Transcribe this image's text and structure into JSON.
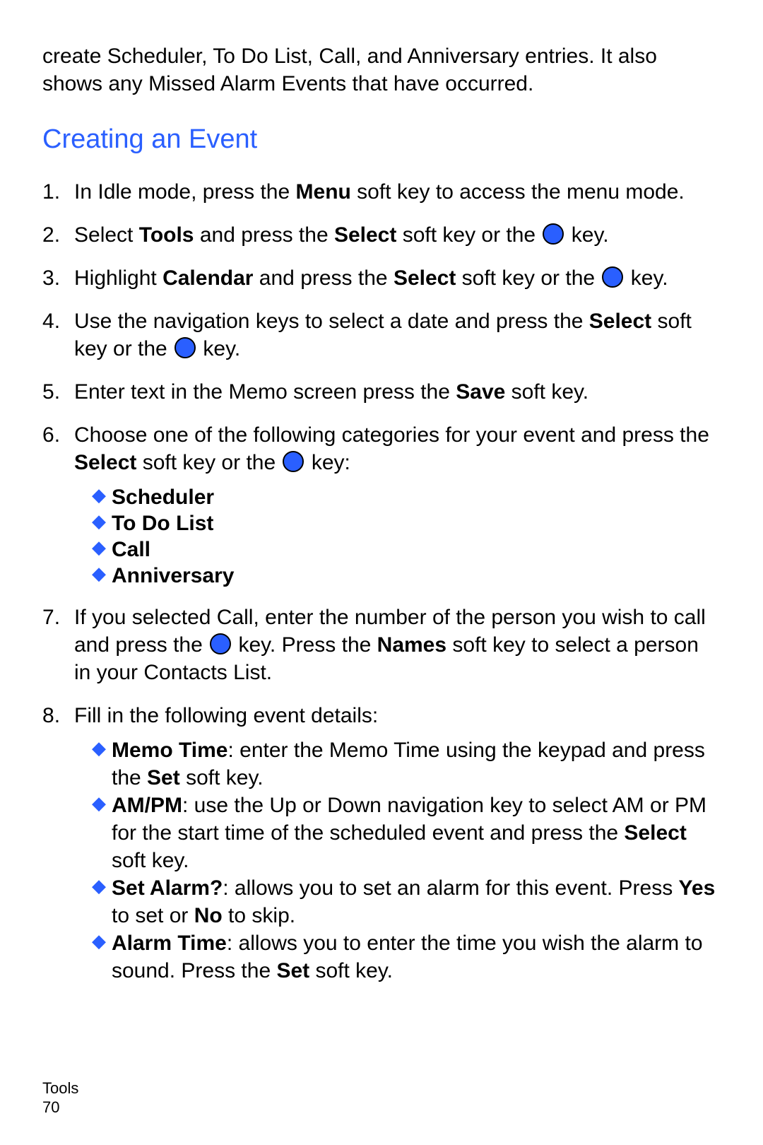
{
  "intro": "create Scheduler, To Do List, Call, and Anniversary entries. It also shows any Missed Alarm Events that have occurred.",
  "heading": "Creating an Event",
  "steps": {
    "s1": {
      "pre": "In Idle mode, press the ",
      "b1": "Menu",
      "post": " soft key to access the menu mode."
    },
    "s2": {
      "pre": "Select ",
      "b1": "Tools",
      "mid": " and press the ",
      "b2": "Select",
      "post1": " soft key or the ",
      "post2": " key."
    },
    "s3": {
      "pre": "Highlight ",
      "b1": "Calendar",
      "mid": " and press the ",
      "b2": "Select",
      "post1": " soft key or the ",
      "post2": " key."
    },
    "s4": {
      "pre": "Use the navigation keys to select a date and press the ",
      "b1": "Select",
      "post1": " soft key or the ",
      "post2": " key."
    },
    "s5": {
      "pre": "Enter text in the Memo screen press the ",
      "b1": "Save",
      "post": " soft key."
    },
    "s6": {
      "pre": "Choose one of the following categories for your event and press the ",
      "b1": "Select",
      "post1": " soft key or the ",
      "post2": " key:"
    },
    "s7": {
      "pre": "If you selected Call, enter the number of the person you wish to call and press the ",
      "post1": " key. Press the ",
      "b1": "Names",
      "post2": " soft key to select a person in your Contacts List."
    },
    "s8": "Fill in the following event details:"
  },
  "categories": {
    "c1": "Scheduler",
    "c2": "To Do List",
    "c3": "Call",
    "c4": "Anniversary"
  },
  "details": {
    "d1": {
      "b1": "Memo Time",
      "t1": ": enter the Memo Time using the keypad and press the ",
      "b2": "Set",
      "t2": " soft key."
    },
    "d2": {
      "b1": "AM/PM",
      "t1": ": use the Up or Down navigation key to select AM or PM for the start time of the scheduled event and press the ",
      "b2": "Select",
      "t2": " soft key."
    },
    "d3": {
      "b1": "Set Alarm?",
      "t1": ": allows you to set an alarm for this event. Press ",
      "b2": "Yes",
      "t2": " to set or ",
      "b3": "No",
      "t3": " to skip."
    },
    "d4": {
      "b1": "Alarm Time",
      "t1": ": allows you to enter the time you wish the alarm to sound. Press the ",
      "b2": "Set",
      "t2": " soft key."
    }
  },
  "footer": {
    "section": "Tools",
    "page": "70"
  }
}
